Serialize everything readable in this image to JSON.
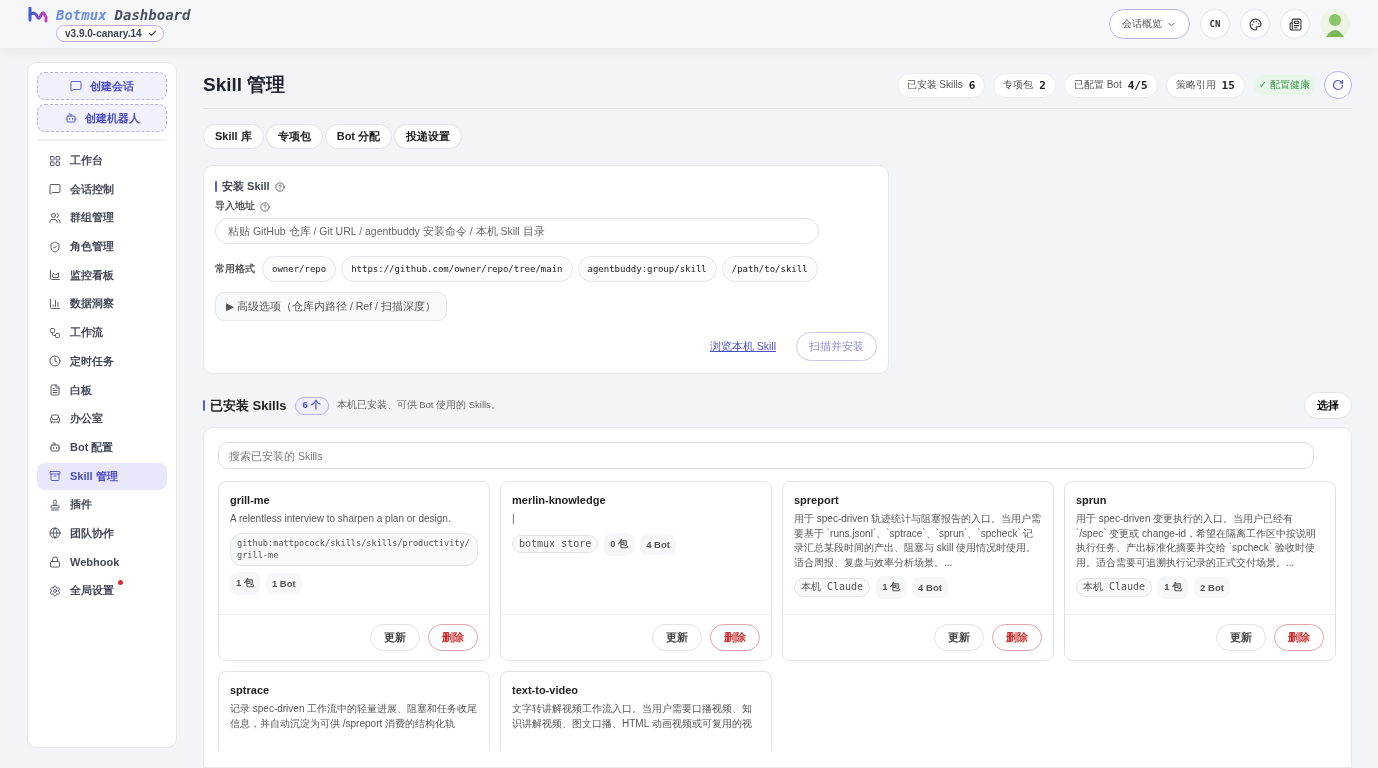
{
  "header": {
    "brand": [
      "Botmux",
      "Dashboard"
    ],
    "version": "v3.9.0-canary.14",
    "view_select": "会话概览",
    "language": "CN"
  },
  "sidebar": {
    "actions": [
      "创建会话",
      "创建机器人"
    ],
    "items": [
      {
        "label": "工作台",
        "selected": false,
        "alert": false
      },
      {
        "label": "会话控制",
        "selected": false,
        "alert": false
      },
      {
        "label": "群组管理",
        "selected": false,
        "alert": false
      },
      {
        "label": "角色管理",
        "selected": false,
        "alert": false
      },
      {
        "label": "监控看板",
        "selected": false,
        "alert": false
      },
      {
        "label": "数据洞察",
        "selected": false,
        "alert": false
      },
      {
        "label": "工作流",
        "selected": false,
        "alert": false
      },
      {
        "label": "定时任务",
        "selected": false,
        "alert": false
      },
      {
        "label": "白板",
        "selected": false,
        "alert": false
      },
      {
        "label": "办公室",
        "selected": false,
        "alert": false
      },
      {
        "label": "Bot 配置",
        "selected": false,
        "alert": false
      },
      {
        "label": "Skill 管理",
        "selected": true,
        "alert": false
      },
      {
        "label": "插件",
        "selected": false,
        "alert": false
      },
      {
        "label": "团队协作",
        "selected": false,
        "alert": false
      },
      {
        "label": "Webhook",
        "selected": false,
        "alert": false
      },
      {
        "label": "全局设置",
        "selected": false,
        "alert": true
      }
    ]
  },
  "page": {
    "title": "Skill 管理",
    "stats": [
      {
        "label": "已安装 Skills",
        "value": "6"
      },
      {
        "label": "专项包",
        "value": "2"
      },
      {
        "label": "已配置 Bot",
        "value": "4/5"
      },
      {
        "label": "策略引用",
        "value": "15"
      }
    ],
    "health": "✓ 配置健康",
    "tabs": [
      {
        "label": "Skill 库",
        "selected": false
      },
      {
        "label": "专项包",
        "selected": false
      },
      {
        "label": "Bot 分配",
        "selected": false
      },
      {
        "label": "投递设置",
        "selected": false
      }
    ]
  },
  "install": {
    "title": "安装 Skill",
    "field_label": "导入地址",
    "placeholder": "粘贴 GitHub 仓库 / Git URL / agentbuddy 安装命令 / 本机 Skill 目录",
    "formats_label": "常用格式",
    "formats": [
      "owner/repo",
      "https://github.com/owner/repo/tree/main",
      "agentbuddy:group/skill",
      "/path/to/skill"
    ],
    "advanced": "▶ 高级选项（仓库内路径 / Ref / 扫描深度）",
    "browse_link": "浏览本机 Skill",
    "install_button": "扫描并安装"
  },
  "installed": {
    "title": "已安装 Skills",
    "count": "6 个",
    "hint": "本机已安装、可供 Bot 使用的 Skills。",
    "select_button": "选择",
    "search_placeholder": "搜索已安装的 Skills",
    "skills": [
      {
        "name": "grill-me",
        "description": "A relentless interview to sharpen a plan or design.",
        "source": "github:mattpocock/skills/skills/productivity/grill-me",
        "packs": "1 包",
        "bots": "1 Bot",
        "buttons": [
          "更新",
          "删除"
        ]
      },
      {
        "name": "merlin-knowledge",
        "description": "|",
        "source": "botmux store",
        "packs": "0 包",
        "bots": "4 Bot",
        "buttons": [
          "更新",
          "删除"
        ]
      },
      {
        "name": "spreport",
        "description": "用于 spec-driven 轨迹统计与阻塞报告的入口。当用户需要基于 `runs.jsonl`、`sptrace`、`sprun`、`spcheck` 记录汇总某段时间的产出、阻塞与 skill 使用情况时使用。适合周报、复盘与效率分析场景。...",
        "source": "本机 Claude",
        "packs": "1 包",
        "bots": "4 Bot",
        "buttons": [
          "更新",
          "删除"
        ]
      },
      {
        "name": "sprun",
        "description": "用于 spec-driven 变更执行的入口。当用户已经有 `/spec` 变更或 change-id，希望在隔离工作区中按说明执行任务、产出标准化摘要并交给 `spcheck` 验收时使用。适合需要可追溯执行记录的正式交付场景。...",
        "source": "本机 Claude",
        "packs": "1 包",
        "bots": "2 Bot",
        "buttons": [
          "更新",
          "删除"
        ]
      },
      {
        "name": "sptrace",
        "description": "记录 spec-driven 工作流中的轻量进展、阻塞和任务收尾信息，并自动沉淀为可供 /spreport 消费的结构化轨"
      },
      {
        "name": "text-to-video",
        "description": "文字转讲解视频工作流入口。当用户需要口播视频、知识讲解视频、图文口播、HTML 动画视频或可复用的视"
      }
    ]
  }
}
